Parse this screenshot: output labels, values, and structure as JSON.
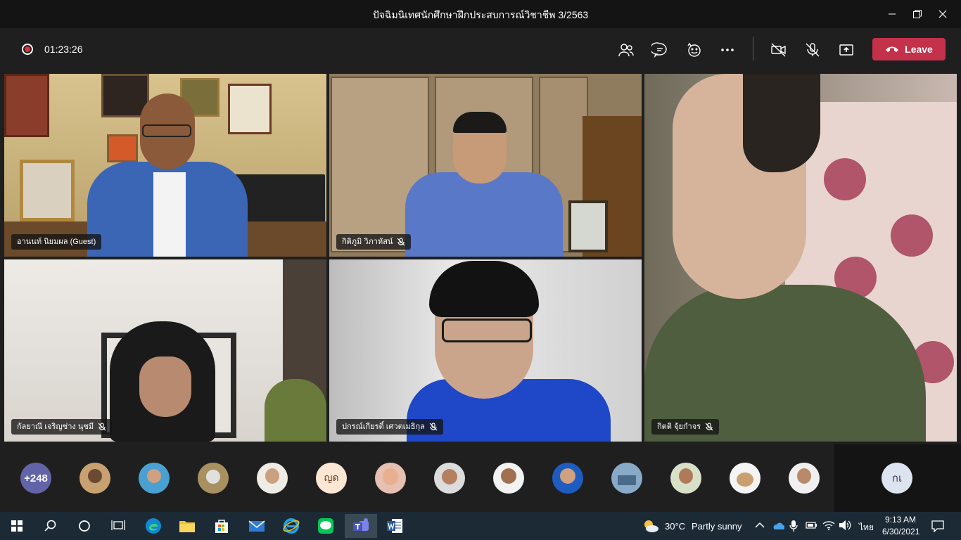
{
  "window": {
    "title": "ปัจฉิมนิเทศนักศึกษาฝึกประสบการณ์วิชาชีพ 3/2563"
  },
  "toolbar": {
    "timer": "01:23:26",
    "leave_label": "Leave"
  },
  "tiles": [
    {
      "name": "อานนท์ นิยมผล (Guest)",
      "muted": false
    },
    {
      "name": "กิติภูมิ วิภาหัสน์",
      "muted": true
    },
    {
      "name": "กิตติ จุ้ยกำจร",
      "muted": true
    },
    {
      "name": "กัลยาณี เจริญช่าง นุชมี",
      "muted": true
    },
    {
      "name": "ปกรณ์เกียรติ์ เศวตเมธิกุล",
      "muted": true
    }
  ],
  "participants": {
    "more_count": "+248",
    "initials_1": "ญด",
    "initials_2": "กเ"
  },
  "taskbar": {
    "weather_temp": "30°C",
    "weather_desc": "Partly sunny",
    "ime": "ไทย",
    "time": "9:13 AM",
    "date": "6/30/2021"
  },
  "colors": {
    "leave": "#c4314b",
    "accent": "#6264a7",
    "record": "#e0323c"
  }
}
